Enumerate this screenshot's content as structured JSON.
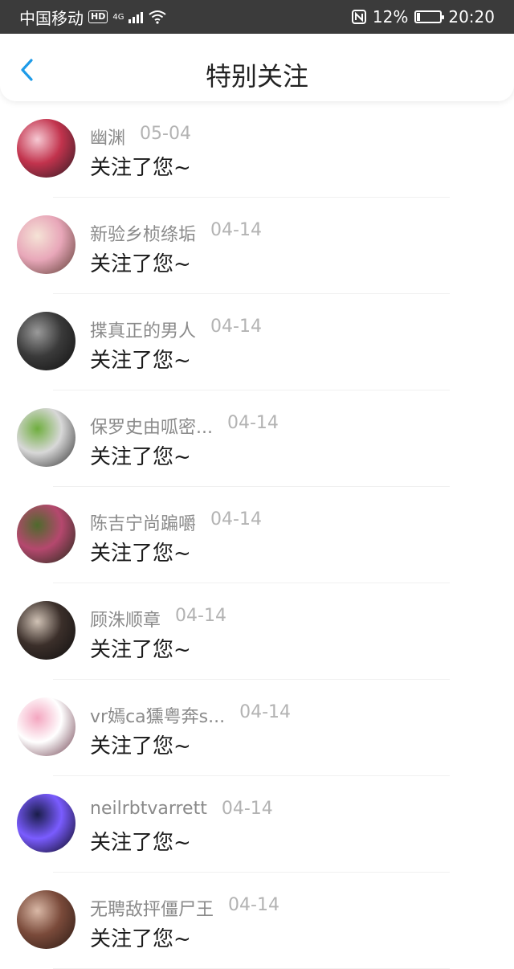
{
  "status_bar": {
    "carrier": "中国移动",
    "hd": "HD",
    "network": "4G",
    "battery": "12%",
    "battery_level": 0.12,
    "time": "20:20"
  },
  "header": {
    "title": "特别关注"
  },
  "items": [
    {
      "name": "幽渊",
      "date": "05-04",
      "action": "关注了您~",
      "avatar_colors": [
        "#f6c9d3",
        "#c2334d",
        "#2a1b22"
      ]
    },
    {
      "name": "新验乡桢绦垢",
      "date": "04-14",
      "action": "关注了您~",
      "avatar_colors": [
        "#f5e3d6",
        "#e8a7b9",
        "#5a3a30"
      ]
    },
    {
      "name": "揲真正的男人",
      "date": "04-14",
      "action": "关注了您~",
      "avatar_colors": [
        "#9a9a9a",
        "#3a3a3a",
        "#101010"
      ]
    },
    {
      "name": "保罗史由呱密...",
      "date": "04-14",
      "action": "关注了您~",
      "avatar_colors": [
        "#6fae3e",
        "#d8d8d8",
        "#2c2c2c"
      ]
    },
    {
      "name": "陈吉宁尚蹁嚼",
      "date": "04-14",
      "action": "关注了您~",
      "avatar_colors": [
        "#4e6a2c",
        "#b5486e",
        "#1f2a17"
      ]
    },
    {
      "name": "顾洙顺章",
      "date": "04-14",
      "action": "关注了您~",
      "avatar_colors": [
        "#d0c2b5",
        "#3b2f2a",
        "#0f0f0f"
      ]
    },
    {
      "name": "vr嫣ca獯粤奔s...",
      "date": "04-14",
      "action": "关注了您~",
      "avatar_colors": [
        "#f4a6c0",
        "#ffffff",
        "#6b3a4a"
      ]
    },
    {
      "name": "neilrbtvarrett",
      "date": "04-14",
      "action": "关注了您~",
      "avatar_colors": [
        "#1a1d4a",
        "#7a5cff",
        "#050510"
      ]
    },
    {
      "name": "无聘敌抨僵尸王",
      "date": "04-14",
      "action": "关注了您~",
      "avatar_colors": [
        "#d9b8a6",
        "#7a4a3a",
        "#2a1a14"
      ]
    }
  ]
}
